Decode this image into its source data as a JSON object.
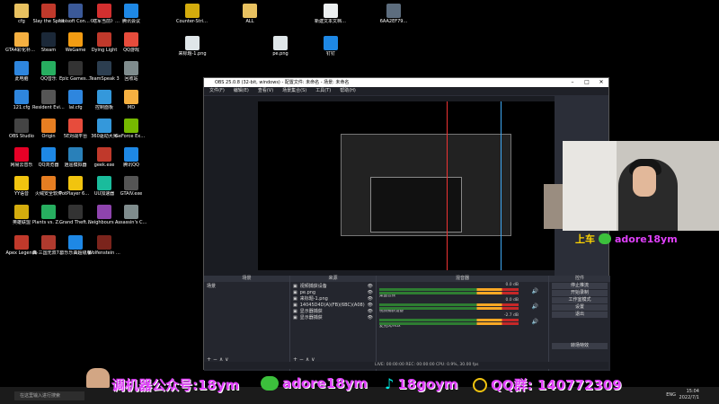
{
  "desktop": {
    "icons": [
      {
        "label": "cfg",
        "color": "#e8c160"
      },
      {
        "label": "Slay the Spire",
        "color": "#c0392b"
      },
      {
        "label": "Ubisoft Connect",
        "color": "#3b5998"
      },
      {
        "label": "《瞎军当前》巴金地) 3...",
        "color": "#d32f2f"
      },
      {
        "label": "腾讯会议",
        "color": "#1e88e5"
      },
      {
        "label": "GTA4彩化补丁20220...",
        "color": "#f5b041"
      },
      {
        "label": "Steam",
        "color": "#1b2838"
      },
      {
        "label": "WeGame",
        "color": "#f39c12"
      },
      {
        "label": "Dying Light",
        "color": "#c0392b"
      },
      {
        "label": "QQ游戏",
        "color": "#e74c3c"
      },
      {
        "label": "此电脑",
        "color": "#2e86de"
      },
      {
        "label": "QQ音乐",
        "color": "#27ae60"
      },
      {
        "label": "Epic Games Launcher",
        "color": "#333333"
      },
      {
        "label": "TeamSpeak 3",
        "color": "#2c3e50"
      },
      {
        "label": "回收站",
        "color": "#7f8c8d"
      },
      {
        "label": "121.cfg",
        "color": "#2e86de"
      },
      {
        "label": "Resident Evil Village",
        "color": "#555555"
      },
      {
        "label": "lal.cfg",
        "color": "#2e86de"
      },
      {
        "label": "控制面板",
        "color": "#3498db"
      },
      {
        "label": "MD",
        "color": "#f5b041"
      },
      {
        "label": "OBS Studio",
        "color": "#444444"
      },
      {
        "label": "Origin",
        "color": "#e67e22"
      },
      {
        "label": "5E对战平台",
        "color": "#e74c3c"
      },
      {
        "label": "360驱动大师",
        "color": "#3498db"
      },
      {
        "label": "GeForce Experience",
        "color": "#76b900"
      },
      {
        "label": "网易云音乐",
        "color": "#e60026"
      },
      {
        "label": "QQ浏览器",
        "color": "#1e88e5"
      },
      {
        "label": "逍遥模拟器",
        "color": "#2980b9"
      },
      {
        "label": "geek.exe",
        "color": "#c0392b"
      },
      {
        "label": "腾讯QQ",
        "color": "#1e88e5"
      },
      {
        "label": "YY语音",
        "color": "#f1c40f"
      },
      {
        "label": "火绒安全软件",
        "color": "#e67e22"
      },
      {
        "label": "PotPlayer 64 bit",
        "color": "#f1c40f"
      },
      {
        "label": "UU加速器",
        "color": "#1abc9c"
      },
      {
        "label": "GTAIV.exe",
        "color": "#555555"
      },
      {
        "label": "英雄联盟",
        "color": "#d4ac0d"
      },
      {
        "label": "Plants vs. Zombies G...",
        "color": "#27ae60"
      },
      {
        "label": "Grand Theft Auto IV",
        "color": "#333333"
      },
      {
        "label": "Neighbours back Fro...",
        "color": "#8e44ad"
      },
      {
        "label": "Assassin's Creed O...",
        "color": "#7f8c8d"
      },
      {
        "label": "Apex Legends",
        "color": "#c0392b"
      },
      {
        "label": "真·三国无双7 with 猛...",
        "color": "#b03a2e"
      },
      {
        "label": "欧乐乐曲超级版",
        "color": "#1e88e5"
      },
      {
        "label": "Wolfenstein The Old B...",
        "color": "#7b241c"
      },
      {
        "label": "Counter-Strike Global Off...",
        "color": "#d4ac0d"
      },
      {
        "label": "ALL",
        "color": "#e8c160"
      },
      {
        "label": "来标题-1.png",
        "color": "#dfe6e9"
      },
      {
        "label": "pe.png",
        "color": "#dfe6e9"
      },
      {
        "label": "新建文本文档.txt",
        "color": "#ecf0f1"
      },
      {
        "label": "6AA2EF79...",
        "color": "#5d6d7e"
      },
      {
        "label": "钉钉",
        "color": "#1e88e5"
      }
    ]
  },
  "obs": {
    "title": "OBS 25.0.8 (32-bit, windows) - 配置文件: 未命名 - 场景: 未命名",
    "menu": [
      "文件(F)",
      "编辑(E)",
      "查看(V)",
      "场景集合(S)",
      "工具(T)",
      "帮助(H)"
    ],
    "docks": {
      "scenes": {
        "title": "场景",
        "items": [
          "场景"
        ]
      },
      "sources": {
        "title": "来源",
        "items": [
          "视频捕获设备",
          "pe.png",
          "来标题-1.png",
          "14045D4D(A)(FB)(6BC)(A08)",
          "显示器捕获",
          "显示器捕获"
        ]
      },
      "mixer": {
        "title": "混音器",
        "channels": [
          {
            "name": "桌面音频",
            "db": "0.0 dB"
          },
          {
            "name": "视频捕获设备",
            "db": "0.0 dB"
          },
          {
            "name": "麦克风/Aux",
            "db": "-2.7 dB"
          }
        ]
      },
      "transitions": {
        "title": "转场特效"
      },
      "controls": {
        "title": "控件",
        "buttons": [
          "停止推流",
          "开始录制",
          "工作室模式",
          "设置",
          "退出"
        ]
      }
    },
    "status": "LIVE: 00:00:00   REC: 00:00:00   CPU: 0.9%, 30.00 fps",
    "dock_foot": "+ − ∧ ∨"
  },
  "overlay": {
    "wechat_id": "adore18ym",
    "wechat_prefix": "上车"
  },
  "banner": {
    "item1": "调机器公众号:18ym",
    "item2": "adore18ym",
    "item3": "18goym",
    "item4": "QQ群: 140772309"
  },
  "taskbar": {
    "search_placeholder": "在这里输入进行搜索",
    "lang": "ENG",
    "time": "15:04",
    "date": "2022/7/1"
  }
}
